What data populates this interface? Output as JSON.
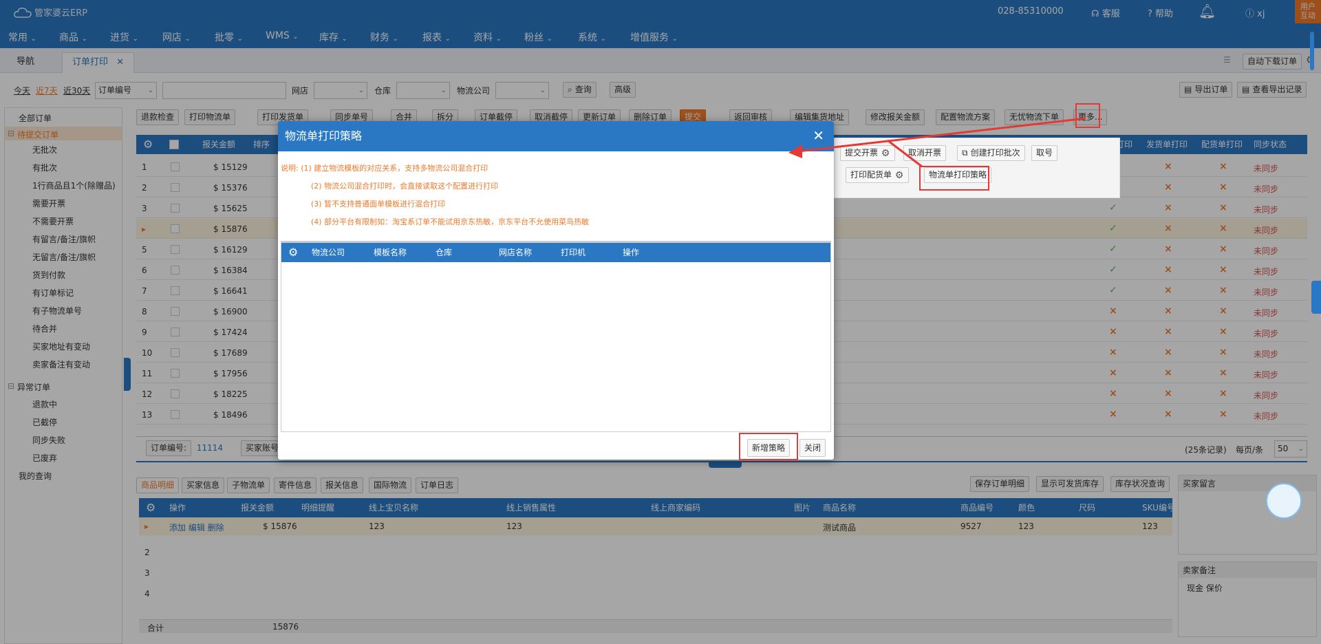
{
  "app": {
    "logo": "管家婆云ERP",
    "phone": "028-85310000",
    "service": "客服",
    "help": "帮助",
    "user": "xj",
    "user_interact": "用户\n互动"
  },
  "menu": [
    "常用",
    "商品",
    "进货",
    "网店",
    "批零",
    "WMS",
    "库存",
    "财务",
    "报表",
    "资料",
    "粉丝",
    "系统",
    "增值服务"
  ],
  "tabs": {
    "nav": "导航",
    "current": "订单打印",
    "auto_download": "自动下载订单"
  },
  "filter": {
    "today": "今天",
    "last7": "近7天",
    "last30": "近30天",
    "field": "订单编号",
    "shop_label": "网店",
    "warehouse_label": "仓库",
    "logistics_label": "物流公司",
    "query": "查询",
    "advanced": "高级",
    "export": "导出订单",
    "view_export": "查看导出记录"
  },
  "sidebar": {
    "all": "全部订单",
    "pending": "待提交订单",
    "items": [
      "无批次",
      "有批次",
      "1行商品且1个(除赠品)",
      "需要开票",
      "不需要开票",
      "有留言/备注/旗帜",
      "无留言/备注/旗帜",
      "货到付款",
      "有订单标记",
      "有子物流单号",
      "待合并",
      "买家地址有变动",
      "卖家备注有变动"
    ],
    "abnormal": "异常订单",
    "abn_items": [
      "退款中",
      "已截停",
      "同步失败",
      "已废弃"
    ],
    "my_query": "我的查询"
  },
  "toolbar": [
    "退款检查",
    "打印物流单",
    "打印发货单",
    "同步单号",
    "合并",
    "拆分",
    "订单截停",
    "取消截停",
    "更新订单",
    "删除订单",
    "提交",
    "返回审核",
    "编辑集货地址",
    "修改报关金额",
    "配置物流方案",
    "无忧物流下单",
    "更多..."
  ],
  "grid": {
    "headers": {
      "amount": "报关金额",
      "sort": "排序",
      "print": "打印",
      "ship_print": "发货单打印",
      "pick_print": "配货单打印",
      "sync": "同步状态"
    },
    "rows": [
      {
        "n": "1",
        "amt": "$ 15129",
        "p": "",
        "s": "×",
        "pk": "×",
        "sync": "未同步"
      },
      {
        "n": "2",
        "amt": "$ 15376",
        "p": "",
        "s": "×",
        "pk": "×",
        "sync": "未同步"
      },
      {
        "n": "3",
        "amt": "$ 15625",
        "p": "✓",
        "s": "×",
        "pk": "×",
        "sync": "未同步"
      },
      {
        "n": "▸",
        "amt": "$ 15876",
        "p": "✓",
        "s": "×",
        "pk": "×",
        "sync": "未同步"
      },
      {
        "n": "5",
        "amt": "$ 16129",
        "p": "✓",
        "s": "×",
        "pk": "×",
        "sync": "未同步"
      },
      {
        "n": "6",
        "amt": "$ 16384",
        "p": "✓",
        "s": "×",
        "pk": "×",
        "sync": "未同步"
      },
      {
        "n": "7",
        "amt": "$ 16641",
        "p": "✓",
        "s": "×",
        "pk": "×",
        "sync": "未同步"
      },
      {
        "n": "8",
        "amt": "$ 16900",
        "p": "×",
        "s": "×",
        "pk": "×",
        "sync": "未同步"
      },
      {
        "n": "9",
        "amt": "$ 17424",
        "p": "×",
        "s": "×",
        "pk": "×",
        "sync": "未同步"
      },
      {
        "n": "10",
        "amt": "$ 17689",
        "p": "×",
        "s": "×",
        "pk": "×",
        "sync": "未同步"
      },
      {
        "n": "11",
        "amt": "$ 17956",
        "p": "×",
        "s": "×",
        "pk": "×",
        "sync": "未同步"
      },
      {
        "n": "12",
        "amt": "$ 18225",
        "p": "×",
        "s": "×",
        "pk": "×",
        "sync": "未同步"
      },
      {
        "n": "13",
        "amt": "$ 18496",
        "p": "×",
        "s": "×",
        "pk": "×",
        "sync": "未同步"
      }
    ],
    "footer": {
      "order_no_label": "订单编号:",
      "order_no": "11114",
      "buyer": "买家账号",
      "records": "(25条记录)",
      "per_page": "每页/条",
      "page_size": "50"
    }
  },
  "popup": {
    "submit_invoice": "提交开票",
    "cancel_invoice": "取消开票",
    "create_batch": "创建打印批次",
    "take_no": "取号",
    "print_pick": "打印配货单",
    "strategy": "物流单打印策略"
  },
  "bottom": {
    "tabs": [
      "商品明细",
      "买家信息",
      "子物流单",
      "寄件信息",
      "报关信息",
      "国际物流",
      "订单日志"
    ],
    "save": "保存订单明细",
    "show_stock": "显示可发货库存",
    "stock_query": "库存状况查询",
    "headers": [
      "操作",
      "报关金额",
      "明细提醒",
      "线上宝贝名称",
      "线上销售属性",
      "线上商家编码",
      "图片",
      "商品名称",
      "商品编号",
      "颜色",
      "尺码",
      "SKU编号"
    ],
    "row": {
      "ops": "添加 编辑 删除",
      "amt": "$ 15876",
      "baby": "123",
      "attr": "123",
      "name": "测试商品",
      "code": "9527",
      "color": "123",
      "sku": "123"
    },
    "total_label": "合计",
    "total": "15876",
    "buyer_msg": "买家留言",
    "seller_note": "卖家备注",
    "seller_note_val": "现金 保价"
  },
  "dialog": {
    "title": "物流单打印策略",
    "notes": [
      "说明: (1) 建立物流模板的对应关系，支持多物流公司混合打印",
      "(2) 物流公司混合打印时，会直接读取这个配置进行打印",
      "(3) 暂不支持普通面单模板进行混合打印",
      "(4) 部分平台有限制如：淘宝系订单不能试用京东热敏，京东平台不允使用菜鸟热敏"
    ],
    "headers": [
      "物流公司",
      "模板名称",
      "仓库",
      "网店名称",
      "打印机",
      "操作"
    ],
    "add": "新增策略",
    "close": "关闭"
  },
  "colors": {
    "primary": "#2a78c4",
    "accent": "#f07a2a",
    "alert": "#e53935"
  }
}
